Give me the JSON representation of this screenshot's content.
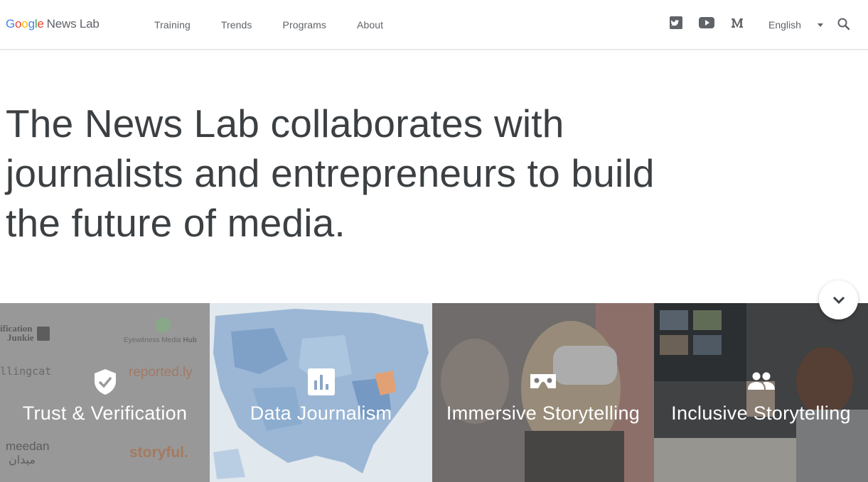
{
  "header": {
    "logo_google": "Google",
    "logo_product": "News Lab",
    "nav": [
      "Training",
      "Trends",
      "Programs",
      "About"
    ],
    "language": "English"
  },
  "hero": {
    "line1": "The News Lab collaborates with",
    "line2": "journalists and entrepreneurs to build",
    "line3": "the future of media."
  },
  "tiles": [
    {
      "title": "Trust & Verification",
      "icon": "verified-shield-icon"
    },
    {
      "title": "Data Journalism",
      "icon": "bar-chart-icon"
    },
    {
      "title": "Immersive Storytelling",
      "icon": "vr-headset-icon"
    },
    {
      "title": "Inclusive Storytelling",
      "icon": "people-icon"
    }
  ],
  "tile1_logos": [
    "ification Junkie",
    "Eyewitness Media Hub",
    "llingcat",
    "reported.ly",
    "meedan",
    "ميدان",
    "storyful."
  ],
  "colors": {
    "google_blue": "#4285f4",
    "google_red": "#ea4335",
    "google_yellow": "#fbbc05",
    "google_green": "#34a853",
    "text": "#3c4043"
  }
}
